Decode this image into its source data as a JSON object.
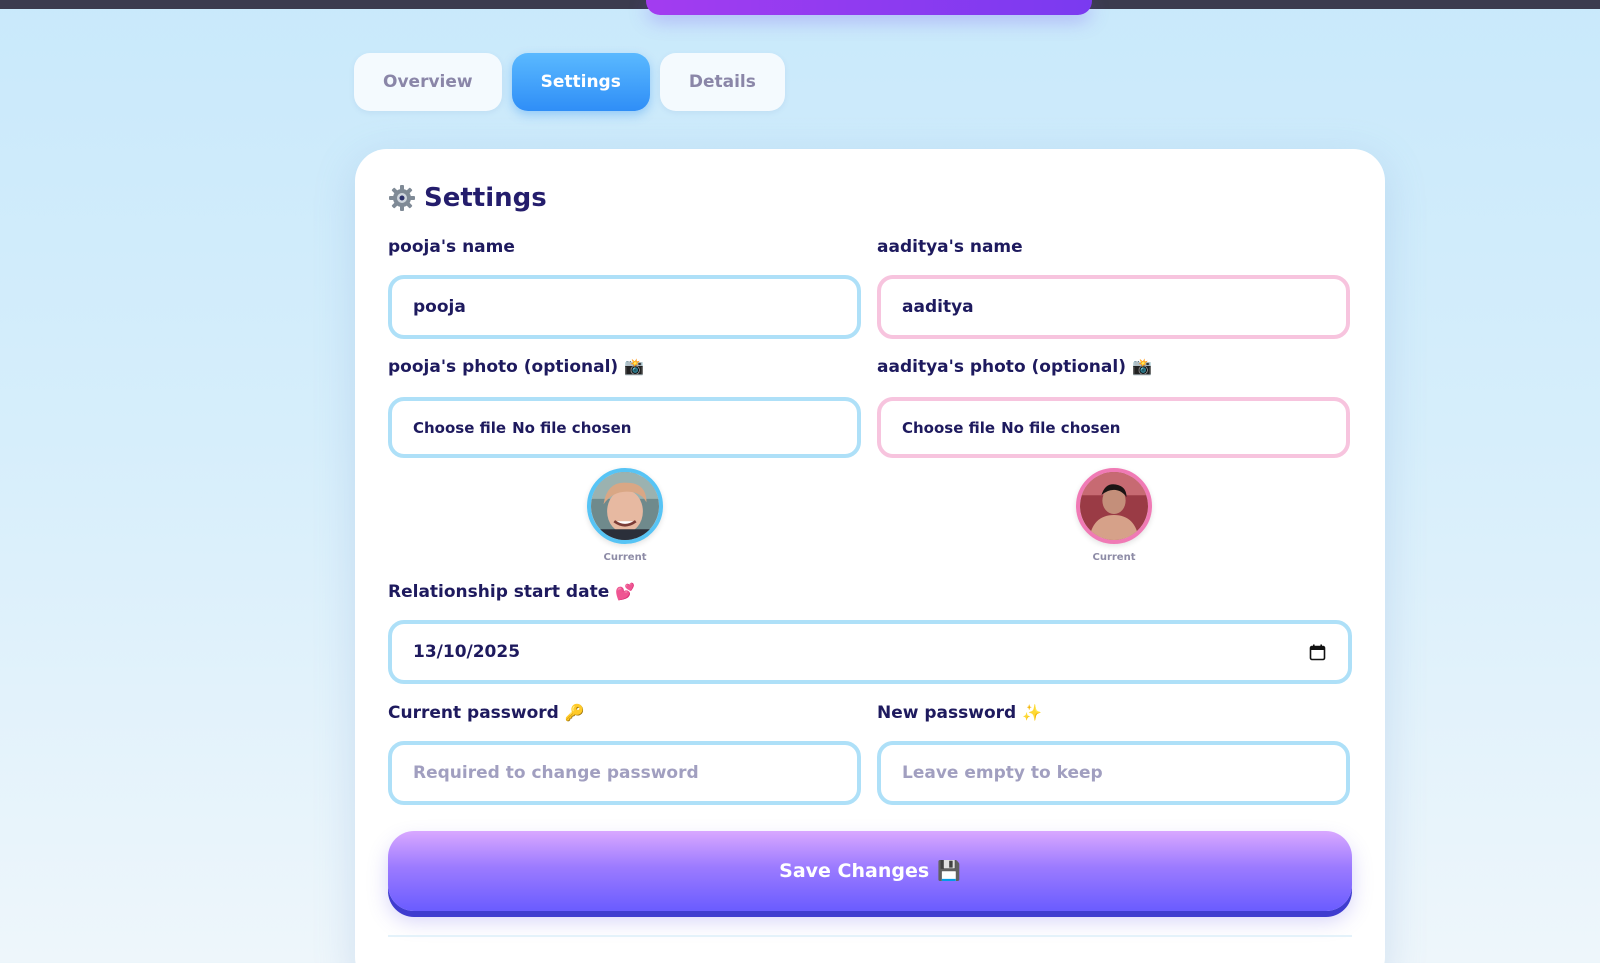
{
  "tabs": [
    {
      "label": "Overview",
      "active": false
    },
    {
      "label": "Settings",
      "active": true
    },
    {
      "label": "Details",
      "active": false
    }
  ],
  "settings": {
    "title": "Settings",
    "partner1": {
      "name_label": "pooja's name",
      "name_value": "pooja",
      "photo_label": "pooja's photo (optional)",
      "file_button": "Choose file",
      "file_status": "No file chosen",
      "avatar_caption": "Current"
    },
    "partner2": {
      "name_label": "aaditya's name",
      "name_value": "aaditya",
      "photo_label": "aaditya's photo (optional)",
      "file_button": "Choose file",
      "file_status": "No file chosen",
      "avatar_caption": "Current"
    },
    "start_date_label": "Relationship start date",
    "start_date_value": "13/10/2025",
    "current_password_label": "Current password",
    "current_password_placeholder": "Required to change password",
    "new_password_label": "New password",
    "new_password_placeholder": "Leave empty to keep",
    "save_label": "Save Changes"
  },
  "colors": {
    "accent_blue": "#2f8ef7",
    "input_border_blue": "#aee0f8",
    "input_border_pink": "#f7c4de",
    "save_gradient_end": "#6a5cff"
  },
  "icons": {
    "title": "gear-icon",
    "photo": "camera-icon",
    "date": "two-hearts-icon",
    "current_password": "key-icon",
    "new_password": "sparkles-icon",
    "save": "floppy-disk-icon",
    "date_picker": "calendar-icon"
  }
}
